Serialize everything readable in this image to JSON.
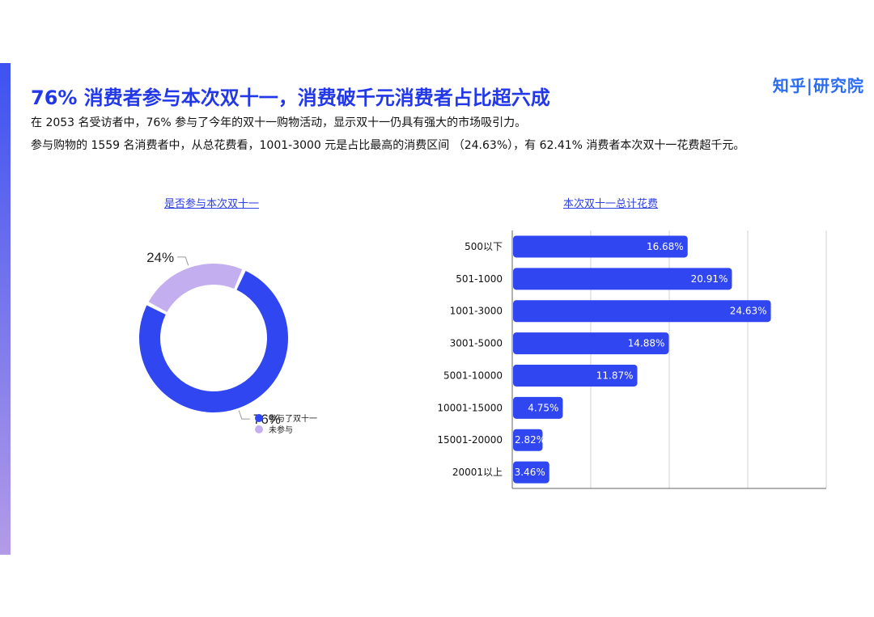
{
  "brand": "知乎|研究院",
  "title": "76% 消费者参与本次双十一，消费破千元消费者占比超六成",
  "description": [
    "在 2053 名受访者中，76% 参与了今年的双十一购物活动，显示双十一仍具有强大的市场吸引力。",
    "参与购物的 1559 名消费者中，从总花费看，1001-3000 元是占比最高的消费区间 （24.63%），有 62.41% 消费者本次双十一花费超千元。"
  ],
  "colors": {
    "accent": "#2f46f0",
    "secondary": "#c3aef0",
    "title": "#2238e8"
  },
  "chart_data": [
    {
      "type": "pie",
      "title": "是否参与本次双十一",
      "labels": [
        "参与了双十一",
        "未参与"
      ],
      "values": [
        76,
        24
      ],
      "value_labels": [
        "76%",
        "24%"
      ],
      "colors": [
        "#2f46f0",
        "#c3aef0"
      ],
      "legend": "bottom"
    },
    {
      "type": "bar",
      "orientation": "horizontal",
      "title": "本次双十一总计花费",
      "categories": [
        "500以下",
        "501-1000",
        "1001-3000",
        "3001-5000",
        "5001-10000",
        "10001-15000",
        "15001-20000",
        "20001以上"
      ],
      "values": [
        16.68,
        20.91,
        24.63,
        14.88,
        11.87,
        4.75,
        2.82,
        3.46
      ],
      "value_labels": [
        "16.68%",
        "20.91%",
        "24.63%",
        "14.88%",
        "11.87%",
        "4.75%",
        "2.82%",
        "3.46%"
      ],
      "xlim": [
        0,
        30
      ],
      "grid": true,
      "color": "#2f46f0"
    }
  ]
}
